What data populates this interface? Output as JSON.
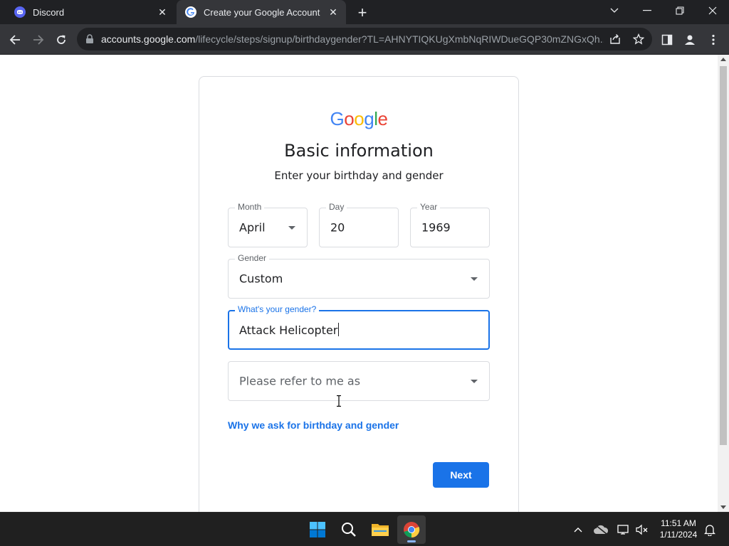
{
  "browser": {
    "tabs": [
      {
        "title": "Discord",
        "icon": "discord-icon",
        "active": false
      },
      {
        "title": "Create your Google Account",
        "icon": "google-icon",
        "active": true
      }
    ],
    "address_host": "accounts.google.com",
    "address_path": "/lifecycle/steps/signup/birthdaygender?TL=AHNYTIQKUgXmbNqRIWDueGQP30mZNGxQh..."
  },
  "page": {
    "logo": [
      "G",
      "o",
      "o",
      "g",
      "l",
      "e"
    ],
    "heading": "Basic information",
    "subheading": "Enter your birthday and gender",
    "month": {
      "label": "Month",
      "value": "April"
    },
    "day": {
      "label": "Day",
      "value": "20"
    },
    "year": {
      "label": "Year",
      "value": "1969"
    },
    "gender": {
      "label": "Gender",
      "value": "Custom"
    },
    "custom_gender": {
      "label": "What's your gender?",
      "value": "Attack Helicopter"
    },
    "pronoun": {
      "placeholder": "Please refer to me as"
    },
    "why_link": "Why we ask for birthday and gender",
    "next_label": "Next"
  },
  "taskbar": {
    "time": "11:51 AM",
    "date": "1/11/2024"
  },
  "colors": {
    "accent": "#1a73e8",
    "google_blue": "#4285f4",
    "google_red": "#ea4335",
    "google_yellow": "#fbbc05",
    "google_green": "#34a853"
  }
}
